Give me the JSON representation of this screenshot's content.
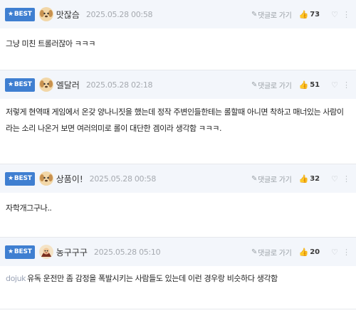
{
  "reply_label": "댓글로 가기",
  "best_label": "BEST",
  "comments": [
    {
      "nickname": "맛잖슴",
      "date": "2025.05.28 00:58",
      "likes": "73",
      "text": "그냥 미친 트롤러잖아 ㅋㅋㅋ",
      "prefix": ""
    },
    {
      "nickname": "엘달러",
      "date": "2025.05.28 02:18",
      "likes": "51",
      "text": "저렇게 현역때 게임에서 온갖 양나니짓을 했는데 정작 주변인들한테는 롤할때 아니면 착하고 매너있는 사람이라는 소리 나온거 보면 여러의미로 롤이 대단한 겜이라 생각함 ㅋㅋㅋ.",
      "prefix": ""
    },
    {
      "nickname": "상품이!",
      "date": "2025.05.28 00:58",
      "likes": "32",
      "text": "자학개그구나..",
      "prefix": ""
    },
    {
      "nickname": "농구구구",
      "date": "2025.05.28 05:10",
      "likes": "20",
      "text": "유독 운전만 좀 감정을 폭발시키는 사람들도 있는데 이런 경우랑 비슷하다 생각함",
      "prefix": "dojuk"
    }
  ],
  "colors": {
    "badge": "#3f7fd1",
    "header_bg": "#f3f6fb",
    "date": "#a6aab0"
  },
  "icons": [
    "star-icon",
    "pencil-icon",
    "thumbs-up-icon",
    "like-outline-icon",
    "more-icon"
  ]
}
